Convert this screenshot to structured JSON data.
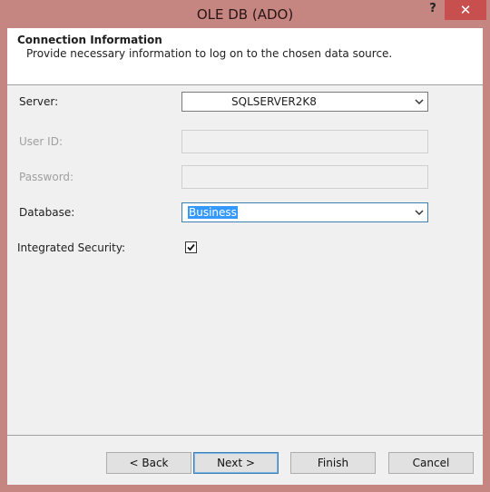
{
  "window": {
    "title": "OLE DB (ADO)",
    "help_label": "?",
    "close_label": "✕"
  },
  "header": {
    "title": "Connection Information",
    "subtitle": "Provide necessary information to log on to the chosen data source."
  },
  "form": {
    "server_label": "Server:",
    "server_value": "SQLSERVER2K8",
    "userid_label": "User ID:",
    "userid_value": "",
    "password_label": "Password:",
    "password_value": "",
    "database_label": "Database:",
    "database_value": "Business",
    "integrated_security_label": "Integrated Security:",
    "integrated_security_checked": true
  },
  "buttons": {
    "back": "< Back",
    "next": "Next >",
    "finish": "Finish",
    "cancel": "Cancel"
  },
  "colors": {
    "window_frame": "#c58581",
    "close_button": "#c7504f",
    "selection": "#3399ff"
  }
}
